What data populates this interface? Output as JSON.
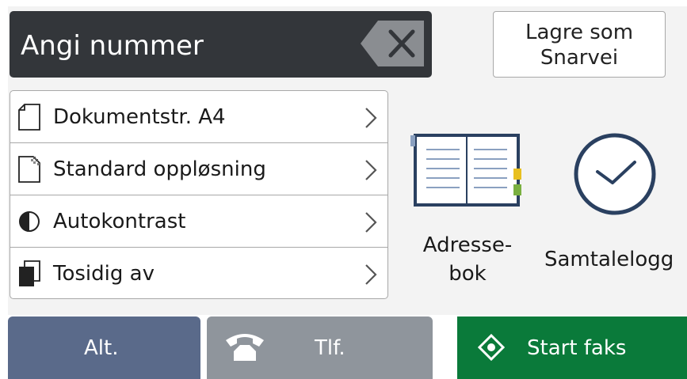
{
  "number_field": {
    "value": "Angi nummer",
    "backspace_icon": "backspace-icon"
  },
  "shortcut_button": {
    "line1": "Lagre som",
    "line2": "Snarvei"
  },
  "settings": [
    {
      "label": "Dokumentstr. A4",
      "icon": "document-size-icon"
    },
    {
      "label": "Standard oppløsning",
      "icon": "resolution-icon"
    },
    {
      "label": "Autokontrast",
      "icon": "contrast-icon"
    },
    {
      "label": "Tosidig av",
      "icon": "duplex-icon"
    }
  ],
  "address_book": {
    "line1": "Adresse-",
    "line2": "bok",
    "icon": "address-book-icon"
  },
  "call_log": {
    "label": "Samtalelogg",
    "icon": "clock-icon"
  },
  "bottom": {
    "alt_label": "Alt.",
    "tel_label": "Tlf.",
    "start_label": "Start faks"
  },
  "colors": {
    "field_bg": "#33363a",
    "alt_bg": "#5a6a8a",
    "tel_bg": "#8f959c",
    "start_bg": "#0a7a3a"
  }
}
